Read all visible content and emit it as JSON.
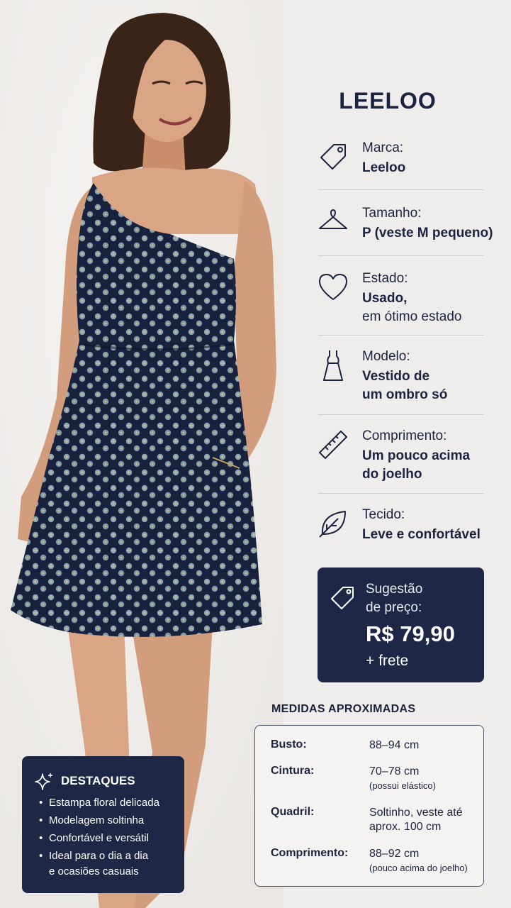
{
  "product": {
    "brand_title": "LEELOO"
  },
  "attributes": [
    {
      "icon": "price-tag-icon",
      "label": "Marca:",
      "value": "Leeloo"
    },
    {
      "icon": "hanger-icon",
      "label": "Tamanho:",
      "value": "P (veste M pequeno)"
    },
    {
      "icon": "heart-icon",
      "label": "Estado:",
      "value": "Usado,",
      "value_sub": "em ótimo estado"
    },
    {
      "icon": "dress-icon",
      "label": "Modelo:",
      "value": "Vestido de",
      "value2": "um ombro só"
    },
    {
      "icon": "ruler-icon",
      "label": "Comprimento:",
      "value": "Um pouco acima",
      "value2": "do joelho"
    },
    {
      "icon": "leaf-icon",
      "label": "Tecido:",
      "value": "Leve e confortável"
    }
  ],
  "price": {
    "label1": "Sugestão",
    "label2": "de preço:",
    "value": "R$ 79,90",
    "shipping": "+ frete"
  },
  "measurements": {
    "title": "MEDIDAS APROXIMADAS",
    "rows": [
      {
        "key": "Busto:",
        "value": "88–94 cm"
      },
      {
        "key": "Cintura:",
        "value": "70–78 cm",
        "note": "(possui elástico)"
      },
      {
        "key": "Quadril:",
        "value": "Soltinho, veste até",
        "value2": "aprox. 100 cm"
      },
      {
        "key": "Comprimento:",
        "value": "88–92 cm",
        "note": "(pouco acima do joelho)"
      }
    ]
  },
  "highlights": {
    "title": "DESTAQUES",
    "items": [
      "Estampa floral delicada",
      "Modelagem soltinha",
      "Confortável e versátil",
      "Ideal para o dia a dia",
      "e ocasiões casuais"
    ]
  },
  "colors": {
    "navy": "#1e2846",
    "text": "#1c2340",
    "background": "#efedeb",
    "skin": "#d9a585"
  }
}
